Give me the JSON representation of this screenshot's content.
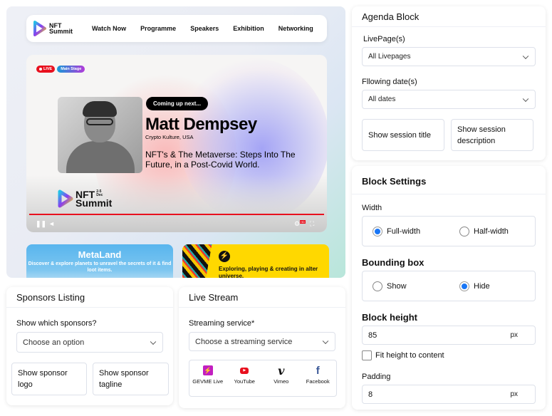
{
  "preview": {
    "nav": {
      "logo_line1": "NFT",
      "logo_line2": "Summit",
      "items": [
        "Watch Now",
        "Programme",
        "Speakers",
        "Exhibition",
        "Networking"
      ]
    },
    "video": {
      "live_badge": "LIVE",
      "stage_badge": "Main Stage",
      "coming_up": "Coming up next...",
      "speaker_name": "Matt Dempsey",
      "speaker_org": "Crypto Kulture, USA",
      "session_title": "NFT's & The Metaverse: Steps Into The Future, in a Post-Covid World.",
      "event_logo_line1": "NFT",
      "event_logo_line2": "Summit",
      "event_date_line1": "2-5",
      "event_date_line2": "Dec",
      "progress_percent": 100,
      "hd_badge": "HD",
      "colors": {
        "live": "#e8101e",
        "progress": "#e8101e"
      }
    },
    "cards": [
      {
        "title": "MetaLand",
        "description": "Discover & explore planets to unravel the secrets of it & find loot items."
      },
      {
        "title": "",
        "description": "Exploring, playing & creating in alter universe."
      }
    ]
  },
  "agenda_block": {
    "title": "Agenda Block",
    "livepages_label": "LivePage(s)",
    "livepages_value": "All Livepages",
    "dates_label": "Fllowing date(s)",
    "dates_value": "All dates",
    "toggle_session_title": "Show session title",
    "toggle_session_description": "Show session description"
  },
  "block_settings": {
    "title": "Block Settings",
    "width_label": "Width",
    "width_options": [
      "Full-width",
      "Half-width"
    ],
    "width_selected": "Full-width",
    "bounding_label": "Bounding box",
    "bounding_options": [
      "Show",
      "Hide"
    ],
    "bounding_selected": "Hide",
    "height_label": "Block height",
    "height_value": "85",
    "height_unit": "px",
    "fit_height_label": "Fit height to content",
    "fit_height_checked": false,
    "padding_label": "Padding",
    "padding_value": "8",
    "padding_unit": "px",
    "accent_color": "#1976f5"
  },
  "sponsors_listing": {
    "title": "Sponsors Listing",
    "question_label": "Show which sponsors?",
    "select_placeholder": "Choose an option",
    "toggle_logo": "Show sponsor logo",
    "toggle_tagline": "Show sponsor tagline"
  },
  "live_stream": {
    "title": "Live Stream",
    "service_label": "Streaming service*",
    "select_placeholder": "Choose a streaming service",
    "services": [
      {
        "name": "GEVME Live",
        "icon": "gevme-bolt-icon",
        "color": "#c21fc0"
      },
      {
        "name": "YouTube",
        "icon": "youtube-icon",
        "color": "#e8101e"
      },
      {
        "name": "Vimeo",
        "icon": "vimeo-icon",
        "color": "#111111"
      },
      {
        "name": "Facebook",
        "icon": "facebook-icon",
        "color": "#3b5998"
      }
    ]
  }
}
